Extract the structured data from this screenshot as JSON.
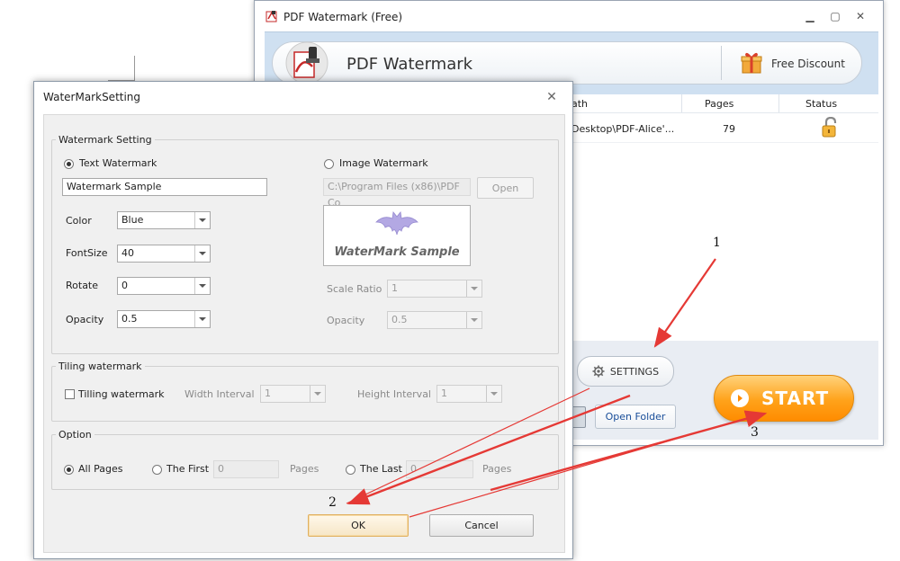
{
  "main_window": {
    "title": "PDF Watermark (Free)",
    "app_name": "PDF Watermark",
    "free_discount": "Free Discount",
    "columns": {
      "path": "ath",
      "pages": "Pages",
      "status": "Status"
    },
    "rows": [
      {
        "path": "Desktop\\PDF-Alice'...",
        "pages": "79",
        "status_icon": "unlock-icon"
      }
    ],
    "settings_label": "SETTINGS",
    "open_folder_label": "Open Folder",
    "start_label": "START",
    "colors": {
      "start_orange": "#ffa21a",
      "header_blue": "#cfe0f1"
    }
  },
  "dialog": {
    "title": "WaterMarkSetting",
    "watermark_group": {
      "title": "Watermark Setting",
      "text_radio": "Text Watermark",
      "text_value": "Watermark Sample",
      "color_label": "Color",
      "color_value": "Blue",
      "fontsize_label": "FontSize",
      "fontsize_value": "40",
      "rotate_label": "Rotate",
      "rotate_value": "0",
      "opacity_label": "Opacity",
      "opacity_value": "0.5",
      "image_radio": "Image Watermark",
      "image_path": "C:\\Program Files (x86)\\PDF Co",
      "open_label": "Open",
      "preview_text": "WaterMark Sample",
      "scale_label": "Scale Ratio",
      "scale_value": "1",
      "image_opacity_label": "Opacity",
      "image_opacity_value": "0.5"
    },
    "tiling_group": {
      "title": "Tiling watermark",
      "checkbox_label": "Tilling watermark",
      "width_label": "Width Interval",
      "width_value": "1",
      "height_label": "Height Interval",
      "height_value": "1"
    },
    "option_group": {
      "title": "Option",
      "all_pages": "All Pages",
      "the_first": "The First",
      "first_value": "0",
      "pages_1": "Pages",
      "the_last": "The Last",
      "last_value": "0",
      "pages_2": "Pages"
    },
    "ok_label": "OK",
    "cancel_label": "Cancel"
  },
  "annotations": {
    "step1": "1",
    "step2": "2",
    "step3": "3",
    "arrow_color": "#e53935"
  }
}
